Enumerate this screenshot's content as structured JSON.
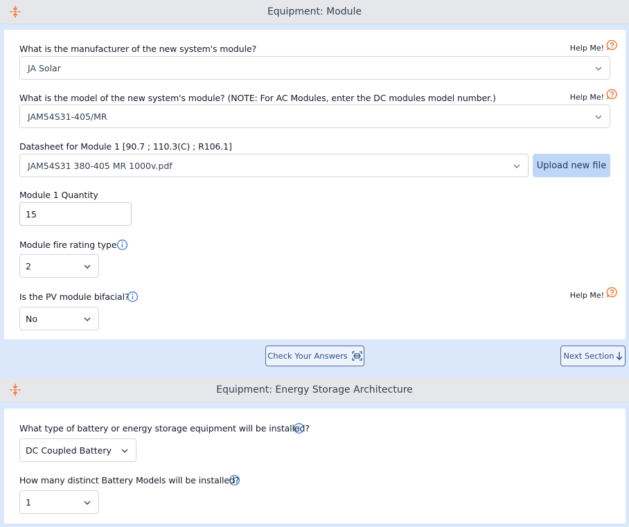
{
  "module_section": {
    "title": "Equipment: Module",
    "help_label": "Help Me!",
    "manufacturer": {
      "question": "What is the manufacturer of the new system's module?",
      "value": "JA Solar"
    },
    "model": {
      "question": "What is the model of the new system's module? (NOTE: For AC Modules, enter the DC modules model number.)",
      "value": "JAM54S31-405/MR"
    },
    "datasheet": {
      "label": "Datasheet for Module 1 [90.7 ; 110.3(C) ; R106.1]",
      "value": "JAM54S31 380-405 MR 1000v.pdf",
      "upload_label": "Upload new file"
    },
    "quantity": {
      "label": "Module 1 Quantity",
      "value": "15"
    },
    "fire_rating": {
      "label": "Module fire rating type",
      "value": "2"
    },
    "bifacial": {
      "label": "Is the PV module bifacial?",
      "value": "No"
    },
    "check_answers_label": "Check Your Answers",
    "next_section_label": "Next Section"
  },
  "storage_section": {
    "title": "Equipment: Energy Storage Architecture",
    "battery_type": {
      "question": "What type of battery or energy storage equipment will be installed?",
      "value": "DC Coupled Battery"
    },
    "battery_models": {
      "question": "How many distinct Battery Models will be installed?",
      "value": "1"
    }
  },
  "colors": {
    "accent_orange": "#f26b21",
    "info_blue": "#2f6fd6",
    "background": "#dbe8fb"
  }
}
